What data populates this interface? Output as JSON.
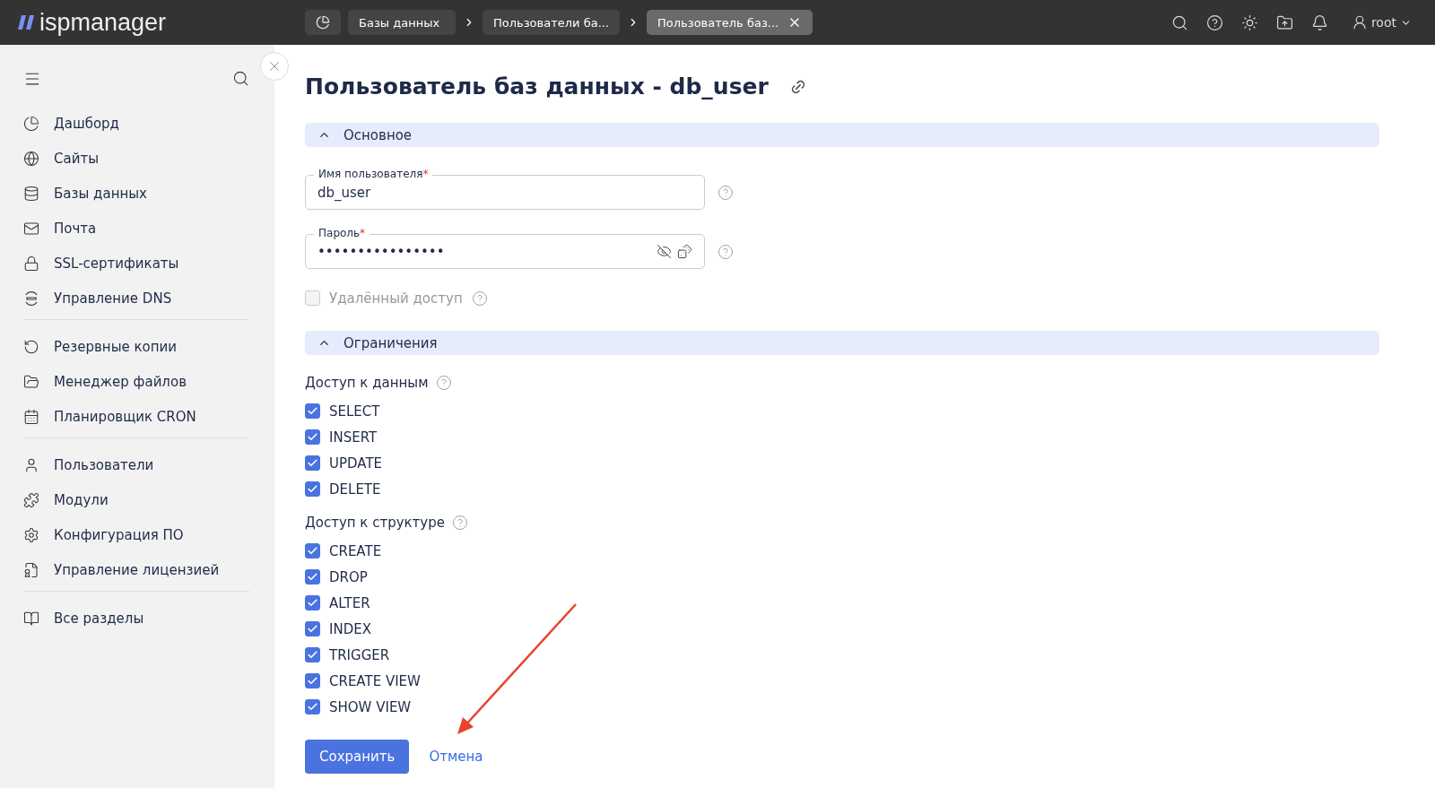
{
  "topbar": {
    "logo": "ispmanager",
    "breadcrumbs": [
      {
        "label": "Базы данных",
        "selected": false
      },
      {
        "label": "Пользователи ба...",
        "selected": false
      },
      {
        "label": "Пользователь баз...",
        "selected": true
      }
    ],
    "user": "root"
  },
  "sidebar": {
    "groups": [
      [
        {
          "label": "Дашборд"
        },
        {
          "label": "Сайты"
        },
        {
          "label": "Базы данных"
        },
        {
          "label": "Почта"
        },
        {
          "label": "SSL-сертификаты"
        },
        {
          "label": "Управление DNS"
        }
      ],
      [
        {
          "label": "Резервные копии"
        },
        {
          "label": "Менеджер файлов"
        },
        {
          "label": "Планировщик CRON"
        }
      ],
      [
        {
          "label": "Пользователи"
        },
        {
          "label": "Модули"
        },
        {
          "label": "Конфигурация ПО"
        },
        {
          "label": "Управление лицензией"
        }
      ],
      [
        {
          "label": "Все разделы"
        }
      ]
    ]
  },
  "form": {
    "title": "Пользователь баз данных - db_user",
    "sections": [
      {
        "title": "Основное",
        "expanded": true
      },
      {
        "title": "Ограничения",
        "expanded": true
      }
    ],
    "fields": [
      {
        "label": "Имя пользователя",
        "required_mark": "*",
        "value": "db_user",
        "kind": "text"
      },
      {
        "label": "Пароль",
        "required_mark": "*",
        "value": "••••••••••••••••",
        "kind": "password"
      }
    ],
    "remote_access": {
      "label": "Удалённый доступ",
      "checked": false,
      "disabled": true
    },
    "groups": [
      {
        "title": "Доступ к данным",
        "options": [
          {
            "label": "SELECT",
            "checked": true
          },
          {
            "label": "INSERT",
            "checked": true
          },
          {
            "label": "UPDATE",
            "checked": true
          },
          {
            "label": "DELETE",
            "checked": true
          }
        ]
      },
      {
        "title": "Доступ к структуре",
        "options": [
          {
            "label": "CREATE",
            "checked": true
          },
          {
            "label": "DROP",
            "checked": true
          },
          {
            "label": "ALTER",
            "checked": true
          },
          {
            "label": "INDEX",
            "checked": true
          },
          {
            "label": "TRIGGER",
            "checked": true
          },
          {
            "label": "CREATE VIEW",
            "checked": true
          },
          {
            "label": "SHOW VIEW",
            "checked": true
          }
        ]
      }
    ],
    "buttons": {
      "save": "Сохранить",
      "cancel": "Отмена"
    }
  }
}
